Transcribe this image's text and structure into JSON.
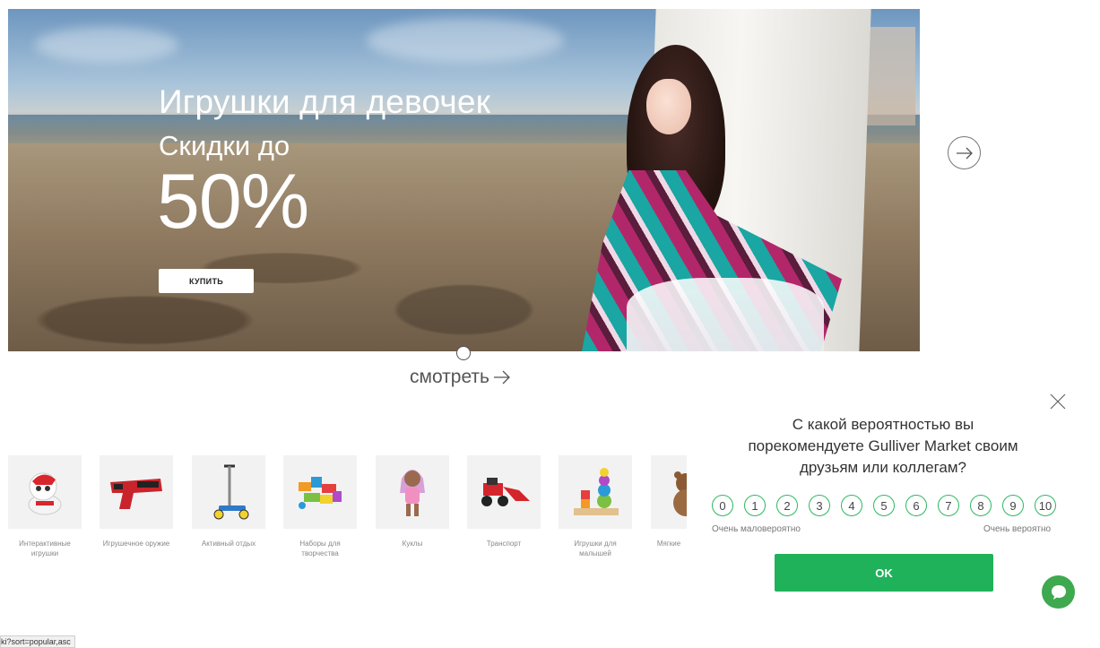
{
  "hero": {
    "title": "Игрушки для девочек",
    "subtitle": "Скидки до",
    "discount": "50%",
    "buy_label": "КУПИТЬ"
  },
  "slider": {
    "next_icon": "arrow-right-circle-icon",
    "watch_label": "смотреть"
  },
  "categories": [
    {
      "label": "Интерактивные игрушки",
      "icon": "robot-dog-icon"
    },
    {
      "label": "Игрушечное оружие",
      "icon": "toy-gun-icon"
    },
    {
      "label": "Активный отдых",
      "icon": "scooter-icon"
    },
    {
      "label": "Наборы для творчества",
      "icon": "craft-set-icon"
    },
    {
      "label": "Куклы",
      "icon": "doll-icon"
    },
    {
      "label": "Транспорт",
      "icon": "excavator-icon"
    },
    {
      "label": "Игрушки для малышей",
      "icon": "stacker-icon"
    },
    {
      "label": "Мягкие",
      "icon": "teddy-bear-icon"
    }
  ],
  "survey": {
    "question": "С какой вероятностью вы порекомендуете Gulliver Market своим друзьям или коллегам?",
    "scores": [
      "0",
      "1",
      "2",
      "3",
      "4",
      "5",
      "6",
      "7",
      "8",
      "9",
      "10"
    ],
    "low_label": "Очень маловероятно",
    "high_label": "Очень вероятно",
    "ok_label": "OK"
  },
  "status_bar_url": "ki?sort=popular,asc",
  "colors": {
    "accent_green": "#1fb25a",
    "score_border": "#2cb860",
    "chat_green": "#3ea94f"
  }
}
